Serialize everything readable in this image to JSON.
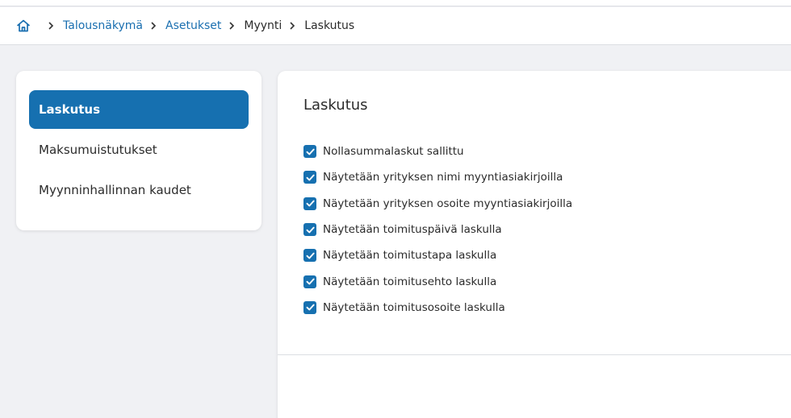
{
  "breadcrumb": {
    "items": [
      {
        "label": "Talousnäkymä",
        "link": true
      },
      {
        "label": "Asetukset",
        "link": true
      },
      {
        "label": "Myynti",
        "link": false
      },
      {
        "label": "Laskutus",
        "link": false
      }
    ]
  },
  "sidebar": {
    "items": [
      {
        "label": "Laskutus",
        "active": true
      },
      {
        "label": "Maksumuistutukset",
        "active": false
      },
      {
        "label": "Myynninhallinnan kaudet",
        "active": false
      }
    ]
  },
  "main": {
    "title": "Laskutus",
    "checkboxes": [
      {
        "label": "Nollasummalaskut sallittu",
        "checked": true
      },
      {
        "label": "Näytetään yrityksen nimi myyntiasiakirjoilla",
        "checked": true
      },
      {
        "label": "Näytetään yrityksen osoite myyntiasiakirjoilla",
        "checked": true
      },
      {
        "label": "Näytetään toimituspäivä laskulla",
        "checked": true
      },
      {
        "label": "Näytetään toimitustapa laskulla",
        "checked": true
      },
      {
        "label": "Näytetään toimitusehto laskulla",
        "checked": true
      },
      {
        "label": "Näytetään toimitusosoite laskulla",
        "checked": true
      }
    ]
  },
  "colors": {
    "accent": "#1670b0",
    "link": "#1a6fb0",
    "background": "#f0f1f4"
  },
  "icons": {
    "home": "home-icon",
    "separator": "chevron-right-icon",
    "check": "check-icon"
  }
}
